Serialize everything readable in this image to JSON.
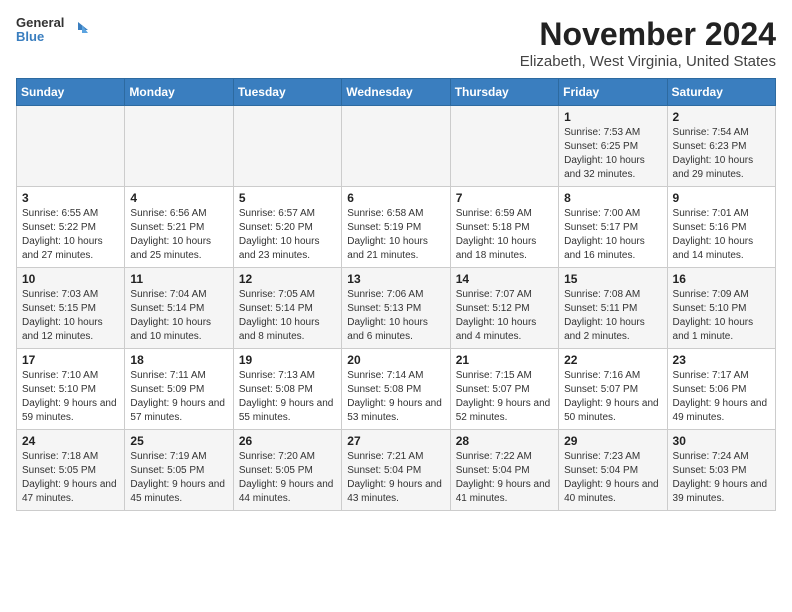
{
  "logo": {
    "general": "General",
    "blue": "Blue"
  },
  "title": "November 2024",
  "subtitle": "Elizabeth, West Virginia, United States",
  "weekdays": [
    "Sunday",
    "Monday",
    "Tuesday",
    "Wednesday",
    "Thursday",
    "Friday",
    "Saturday"
  ],
  "rows": [
    [
      {
        "day": "",
        "info": ""
      },
      {
        "day": "",
        "info": ""
      },
      {
        "day": "",
        "info": ""
      },
      {
        "day": "",
        "info": ""
      },
      {
        "day": "",
        "info": ""
      },
      {
        "day": "1",
        "info": "Sunrise: 7:53 AM\nSunset: 6:25 PM\nDaylight: 10 hours and 32 minutes."
      },
      {
        "day": "2",
        "info": "Sunrise: 7:54 AM\nSunset: 6:23 PM\nDaylight: 10 hours and 29 minutes."
      }
    ],
    [
      {
        "day": "3",
        "info": "Sunrise: 6:55 AM\nSunset: 5:22 PM\nDaylight: 10 hours and 27 minutes."
      },
      {
        "day": "4",
        "info": "Sunrise: 6:56 AM\nSunset: 5:21 PM\nDaylight: 10 hours and 25 minutes."
      },
      {
        "day": "5",
        "info": "Sunrise: 6:57 AM\nSunset: 5:20 PM\nDaylight: 10 hours and 23 minutes."
      },
      {
        "day": "6",
        "info": "Sunrise: 6:58 AM\nSunset: 5:19 PM\nDaylight: 10 hours and 21 minutes."
      },
      {
        "day": "7",
        "info": "Sunrise: 6:59 AM\nSunset: 5:18 PM\nDaylight: 10 hours and 18 minutes."
      },
      {
        "day": "8",
        "info": "Sunrise: 7:00 AM\nSunset: 5:17 PM\nDaylight: 10 hours and 16 minutes."
      },
      {
        "day": "9",
        "info": "Sunrise: 7:01 AM\nSunset: 5:16 PM\nDaylight: 10 hours and 14 minutes."
      }
    ],
    [
      {
        "day": "10",
        "info": "Sunrise: 7:03 AM\nSunset: 5:15 PM\nDaylight: 10 hours and 12 minutes."
      },
      {
        "day": "11",
        "info": "Sunrise: 7:04 AM\nSunset: 5:14 PM\nDaylight: 10 hours and 10 minutes."
      },
      {
        "day": "12",
        "info": "Sunrise: 7:05 AM\nSunset: 5:14 PM\nDaylight: 10 hours and 8 minutes."
      },
      {
        "day": "13",
        "info": "Sunrise: 7:06 AM\nSunset: 5:13 PM\nDaylight: 10 hours and 6 minutes."
      },
      {
        "day": "14",
        "info": "Sunrise: 7:07 AM\nSunset: 5:12 PM\nDaylight: 10 hours and 4 minutes."
      },
      {
        "day": "15",
        "info": "Sunrise: 7:08 AM\nSunset: 5:11 PM\nDaylight: 10 hours and 2 minutes."
      },
      {
        "day": "16",
        "info": "Sunrise: 7:09 AM\nSunset: 5:10 PM\nDaylight: 10 hours and 1 minute."
      }
    ],
    [
      {
        "day": "17",
        "info": "Sunrise: 7:10 AM\nSunset: 5:10 PM\nDaylight: 9 hours and 59 minutes."
      },
      {
        "day": "18",
        "info": "Sunrise: 7:11 AM\nSunset: 5:09 PM\nDaylight: 9 hours and 57 minutes."
      },
      {
        "day": "19",
        "info": "Sunrise: 7:13 AM\nSunset: 5:08 PM\nDaylight: 9 hours and 55 minutes."
      },
      {
        "day": "20",
        "info": "Sunrise: 7:14 AM\nSunset: 5:08 PM\nDaylight: 9 hours and 53 minutes."
      },
      {
        "day": "21",
        "info": "Sunrise: 7:15 AM\nSunset: 5:07 PM\nDaylight: 9 hours and 52 minutes."
      },
      {
        "day": "22",
        "info": "Sunrise: 7:16 AM\nSunset: 5:07 PM\nDaylight: 9 hours and 50 minutes."
      },
      {
        "day": "23",
        "info": "Sunrise: 7:17 AM\nSunset: 5:06 PM\nDaylight: 9 hours and 49 minutes."
      }
    ],
    [
      {
        "day": "24",
        "info": "Sunrise: 7:18 AM\nSunset: 5:05 PM\nDaylight: 9 hours and 47 minutes."
      },
      {
        "day": "25",
        "info": "Sunrise: 7:19 AM\nSunset: 5:05 PM\nDaylight: 9 hours and 45 minutes."
      },
      {
        "day": "26",
        "info": "Sunrise: 7:20 AM\nSunset: 5:05 PM\nDaylight: 9 hours and 44 minutes."
      },
      {
        "day": "27",
        "info": "Sunrise: 7:21 AM\nSunset: 5:04 PM\nDaylight: 9 hours and 43 minutes."
      },
      {
        "day": "28",
        "info": "Sunrise: 7:22 AM\nSunset: 5:04 PM\nDaylight: 9 hours and 41 minutes."
      },
      {
        "day": "29",
        "info": "Sunrise: 7:23 AM\nSunset: 5:04 PM\nDaylight: 9 hours and 40 minutes."
      },
      {
        "day": "30",
        "info": "Sunrise: 7:24 AM\nSunset: 5:03 PM\nDaylight: 9 hours and 39 minutes."
      }
    ]
  ]
}
